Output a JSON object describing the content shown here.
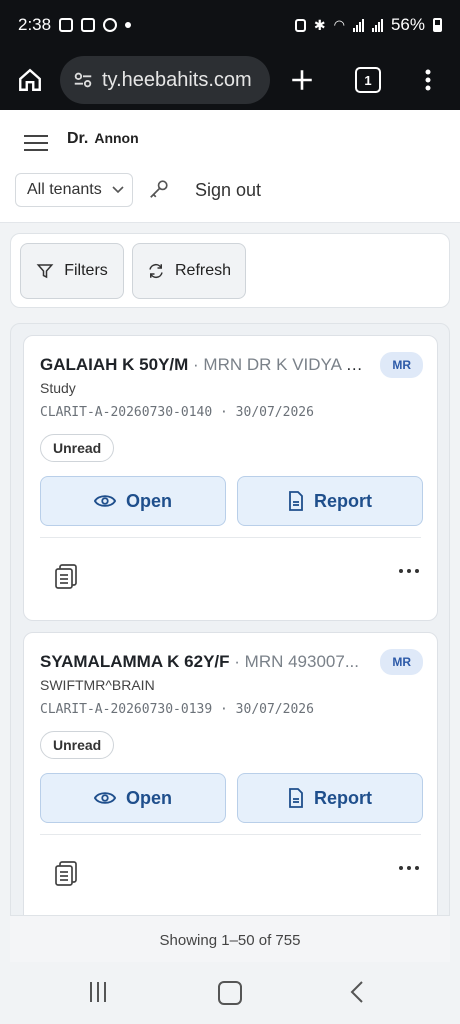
{
  "status_bar": {
    "time": "2:38",
    "battery": "56%"
  },
  "browser": {
    "url": "ty.heebahits.com",
    "tab_count": "1"
  },
  "header": {
    "prefix": "Dr.",
    "doctor_name": "Annon",
    "tenant_selected": "All tenants",
    "signout_label": "Sign out"
  },
  "toolbar": {
    "filters_label": "Filters",
    "refresh_label": "Refresh"
  },
  "studies": [
    {
      "patient": "GALAIAH K 50Y/M",
      "mrn": "· MRN DR K VIDYA S...",
      "modality": "MR",
      "study_desc": "Study",
      "accession": "CLARIT-A-20260730-0140 · 30/07/2026",
      "status": "Unread",
      "open_label": "Open",
      "report_label": "Report"
    },
    {
      "patient": "SYAMALAMMA K 62Y/F",
      "mrn": "· MRN 493007...",
      "modality": "MR",
      "study_desc": "SWIFTMR^BRAIN",
      "accession": "CLARIT-A-20260730-0139 · 30/07/2026",
      "status": "Unread",
      "open_label": "Open",
      "report_label": "Report"
    }
  ],
  "pagination": {
    "summary": "Showing 1–50 of 755"
  },
  "colors": {
    "accent": "#1f4f8c",
    "action_bg": "#e6f0fb",
    "modality_bg": "#dfe9f8"
  }
}
